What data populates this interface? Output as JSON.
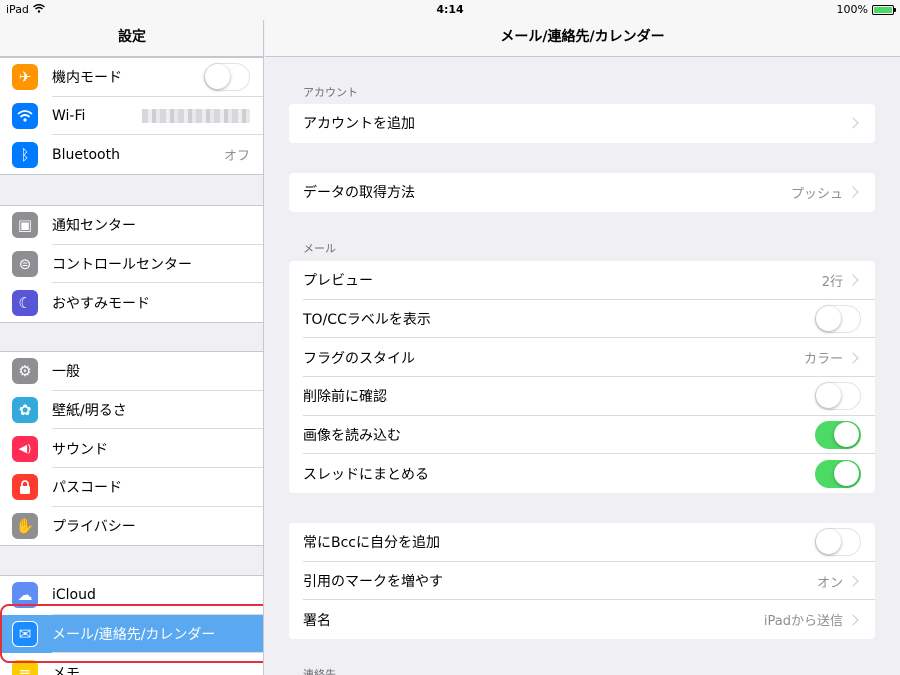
{
  "status": {
    "device": "iPad",
    "time": "4:14",
    "battery": "100%"
  },
  "sidebar": {
    "title": "設定",
    "groups": [
      {
        "items": [
          {
            "label": "機内モード",
            "icon": "airplane-icon",
            "color": "#ff9500",
            "glyph": "✈"
          },
          {
            "label": "Wi-Fi",
            "icon": "wifi-icon",
            "color": "#007aff",
            "glyph": "≋"
          },
          {
            "label": "Bluetooth",
            "icon": "bluetooth-icon",
            "color": "#007aff",
            "glyph": "ᛒ",
            "value": "オフ"
          }
        ]
      },
      {
        "items": [
          {
            "label": "通知センター",
            "icon": "notification-center-icon",
            "color": "#8e8e93",
            "glyph": "▣"
          },
          {
            "label": "コントロールセンター",
            "icon": "control-center-icon",
            "color": "#8e8e93",
            "glyph": "⊜"
          },
          {
            "label": "おやすみモード",
            "icon": "moon-icon",
            "color": "#5856d6",
            "glyph": "☾"
          }
        ]
      },
      {
        "items": [
          {
            "label": "一般",
            "icon": "gear-icon",
            "color": "#8e8e93",
            "glyph": "⚙"
          },
          {
            "label": "壁紙/明るさ",
            "icon": "wallpaper-icon",
            "color": "#34aadc",
            "glyph": "✿"
          },
          {
            "label": "サウンド",
            "icon": "speaker-icon",
            "color": "#ff2d55",
            "glyph": "◀)"
          },
          {
            "label": "パスコード",
            "icon": "lock-icon",
            "color": "#ff3b30",
            "glyph": "🔒"
          },
          {
            "label": "プライバシー",
            "icon": "hand-icon",
            "color": "#8e8e93",
            "glyph": "✋"
          }
        ]
      },
      {
        "items": [
          {
            "label": "iCloud",
            "icon": "cloud-icon",
            "color": "#5e8ef5",
            "glyph": "☁"
          },
          {
            "label": "メール/連絡先/カレンダー",
            "icon": "mail-icon",
            "color": "#1a8cff",
            "glyph": "✉"
          },
          {
            "label": "メモ",
            "icon": "notes-icon",
            "color": "#ffcc00",
            "glyph": "≡"
          }
        ]
      }
    ]
  },
  "main": {
    "title": "メール/連絡先/カレンダー",
    "account_section": "アカウント",
    "add_account": "アカウントを追加",
    "fetch_method": {
      "label": "データの取得方法",
      "value": "プッシュ"
    },
    "mail_section": "メール",
    "mail_rows": [
      {
        "label": "プレビュー",
        "value": "2行"
      },
      {
        "label": "TO/CCラベルを表示"
      },
      {
        "label": "フラグのスタイル",
        "value": "カラー"
      },
      {
        "label": "削除前に確認"
      },
      {
        "label": "画像を読み込む"
      },
      {
        "label": "スレッドにまとめる"
      }
    ],
    "other_rows": [
      {
        "label": "常にBccに自分を追加"
      },
      {
        "label": "引用のマークを増やす",
        "value": "オン"
      },
      {
        "label": "署名",
        "value": "iPadから送信"
      }
    ],
    "contacts_section": "連絡先"
  },
  "colors": {
    "toggle_on": "#4cd964",
    "selection": "#5aa8f0",
    "highlight_border": "#e0323c"
  }
}
